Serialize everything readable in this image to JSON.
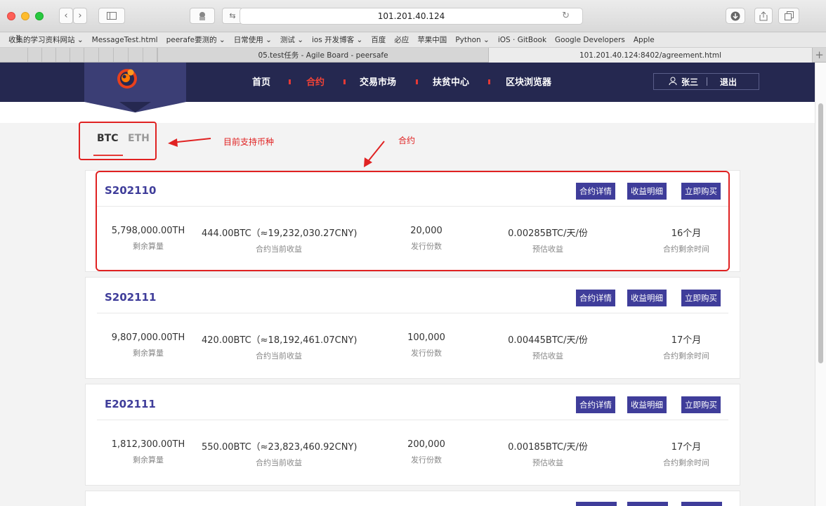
{
  "browser": {
    "url": "101.201.40.124",
    "bookmarks": [
      "收集的学习资料网站 ⌄",
      "MessageTest.html",
      "peerafe要测的 ⌄",
      "日常使用 ⌄",
      "测试 ⌄",
      "ios 开发博客 ⌄",
      "百度",
      "必应",
      "苹果中国",
      "Python ⌄",
      "iOS · GitBook",
      "Google Developers",
      "Apple"
    ],
    "tabs": [
      {
        "title": "05.test任务 - Agile Board - peersafe",
        "active": false
      },
      {
        "title": "101.201.40.124:8402/agreement.html",
        "active": true
      }
    ]
  },
  "nav": {
    "items": [
      {
        "label": "首页",
        "active": false
      },
      {
        "label": "合约",
        "active": true
      },
      {
        "label": "交易市场",
        "active": false
      },
      {
        "label": "扶贫中心",
        "active": false
      },
      {
        "label": "区块浏览器",
        "active": false
      }
    ],
    "user_name": "张三",
    "logout": "退出"
  },
  "coin_tabs": [
    {
      "label": "BTC",
      "active": true
    },
    {
      "label": "ETH",
      "active": false
    }
  ],
  "annotations": {
    "coins": "目前支持币种",
    "contract": "合约"
  },
  "card_buttons": {
    "detail": "合约详情",
    "income": "收益明细",
    "buy": "立即购买"
  },
  "stat_labels": {
    "remaining_power": "剩余算量",
    "current_income": "合约当前收益",
    "issued": "发行份数",
    "estimated": "预估收益",
    "remaining_time": "合约剩余时间"
  },
  "contracts": [
    {
      "id": "S202110",
      "power": "5,798,000.00TH",
      "income": "444.00BTC（≈19,232,030.27CNY)",
      "issued": "20,000",
      "estimated": "0.00285BTC/天/份",
      "time": "16个月"
    },
    {
      "id": "S202111",
      "power": "9,807,000.00TH",
      "income": "420.00BTC（≈18,192,461.07CNY)",
      "issued": "100,000",
      "estimated": "0.00445BTC/天/份",
      "time": "17个月"
    },
    {
      "id": "E202111",
      "power": "1,812,300.00TH",
      "income": "550.00BTC（≈23,823,460.92CNY)",
      "issued": "200,000",
      "estimated": "0.00185BTC/天/份",
      "time": "17个月"
    }
  ],
  "colors": {
    "navbar": "#252850",
    "accent": "#3f3d9a",
    "active_nav": "#f44336",
    "annotation": "#e02222"
  }
}
